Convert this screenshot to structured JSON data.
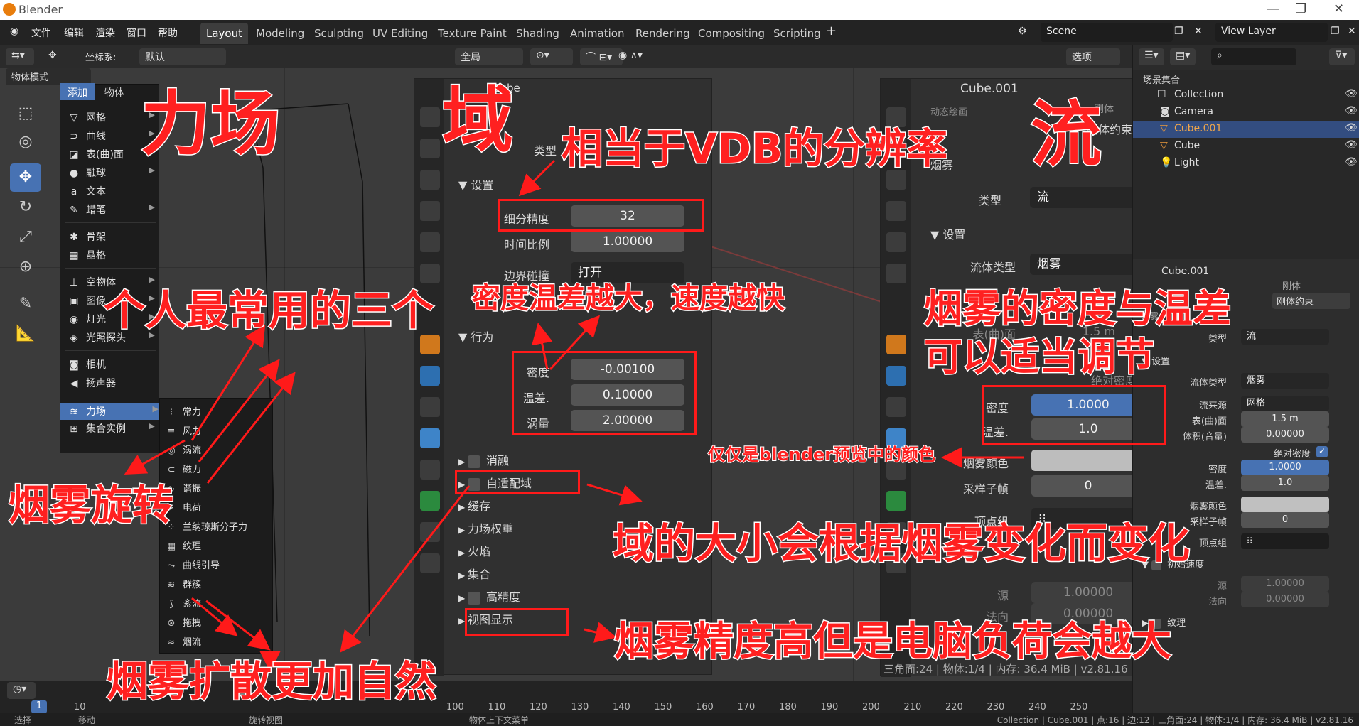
{
  "window": {
    "title": "Blender"
  },
  "menubar": {
    "items": [
      "文件",
      "编辑",
      "渲染",
      "窗口",
      "帮助"
    ],
    "workspace_tabs": [
      "Layout",
      "Modeling",
      "Sculpting",
      "UV Editing",
      "Texture Paint",
      "Shading",
      "Animation",
      "Rendering",
      "Compositing",
      "Scripting"
    ],
    "active_tab": "Layout",
    "scene": "Scene",
    "view_layer": "View Layer"
  },
  "header": {
    "coord_label": "坐标系:",
    "coord_value": "默认",
    "global": "全局",
    "options": "选项",
    "mode": "物体模式"
  },
  "add_menu": {
    "tabs": [
      "添加",
      "物体"
    ],
    "items": [
      {
        "label": "网格",
        "icon": "▽",
        "sub": true
      },
      {
        "label": "曲线",
        "icon": "⊃",
        "sub": true
      },
      {
        "label": "表(曲)面",
        "icon": "◪",
        "sub": true
      },
      {
        "label": "融球",
        "icon": "●",
        "sub": true
      },
      {
        "label": "文本",
        "icon": "a",
        "sub": false
      },
      {
        "label": "蜡笔",
        "icon": "✎",
        "sub": true
      },
      {
        "label": "骨架",
        "icon": "✱",
        "sub": false
      },
      {
        "label": "晶格",
        "icon": "▦",
        "sub": false
      },
      {
        "label": "空物体",
        "icon": "⊥",
        "sub": true
      },
      {
        "label": "图像",
        "icon": "▣",
        "sub": true
      },
      {
        "label": "灯光",
        "icon": "◉",
        "sub": true
      },
      {
        "label": "光照探头",
        "icon": "◈",
        "sub": true
      },
      {
        "label": "相机",
        "icon": "◙",
        "sub": false
      },
      {
        "label": "扬声器",
        "icon": "◀",
        "sub": false
      },
      {
        "label": "力场",
        "icon": "≋",
        "sub": true
      },
      {
        "label": "集合实例",
        "icon": "⊞",
        "sub": true
      }
    ]
  },
  "force_submenu": {
    "items": [
      "常力",
      "风力",
      "涡流",
      "磁力",
      "谐振",
      "电荷",
      "兰纳琼斯分子力",
      "纹理",
      "曲线引导",
      "群簇",
      "紊流",
      "拖拽",
      "烟流"
    ]
  },
  "domain_panel": {
    "object": "Cube",
    "type_label": "类型",
    "settings": "设置",
    "resolution_label": "细分精度",
    "resolution_value": "32",
    "time_scale_label": "时间比例",
    "time_scale_value": "1.00000",
    "border_label": "边界碰撞",
    "border_value": "打开",
    "behavior": "行为",
    "density_label": "密度",
    "density_value": "-0.00100",
    "heat_label": "温差.",
    "heat_value": "0.10000",
    "vorticity_label": "涡量",
    "vorticity_value": "2.00000",
    "sections": [
      "消融",
      "自适配域",
      "缓存",
      "力场权重",
      "火焰",
      "集合",
      "高精度",
      "视图显示"
    ]
  },
  "flow_panel": {
    "object": "Cube.001",
    "smoke": "烟雾",
    "type_label": "类型",
    "type_value": "流",
    "settings": "设置",
    "flow_type_label": "流体类型",
    "flow_type_value": "烟雾",
    "surface": "表(曲)面",
    "surface_value": "1.5 m",
    "abs_density": "绝对密度",
    "density_label": "密度",
    "density_value": "1.0000",
    "heat_label": "温差.",
    "heat_value": "1.0",
    "color_label": "烟雾颜色",
    "subframes_label": "采样子帧",
    "subframes_value": "0",
    "vgroup_label": "顶点组",
    "source_label": "源",
    "source_value": "1.00000",
    "normal_label": "法向",
    "normal_value": "0.00000",
    "top_buttons": [
      "动态绘画",
      "刚体",
      "刚体约束"
    ],
    "status": "三角面:24 | 物体:1/4 | 内存: 36.4 MiB | v2.81.16"
  },
  "outliner": {
    "header": "场景集合",
    "rows": [
      "Collection",
      "Camera",
      "Cube.001",
      "Cube",
      "Light"
    ]
  },
  "side_props": {
    "object": "Cube.001",
    "buttons": [
      "刚体",
      "刚体约束"
    ],
    "smoke": "烟雾",
    "type_label": "类型",
    "type_value": "流",
    "settings": "设置",
    "flow_type_label": "流体类型",
    "flow_type_value": "烟雾",
    "flow_source_label": "流来源",
    "flow_source_value": "网格",
    "surface_label": "表(曲)面",
    "surface_value": "1.5 m",
    "volume_label": "体积(音量)",
    "volume_value": "0.00000",
    "abs_density": "绝对密度",
    "density_label": "密度",
    "density_value": "1.0000",
    "heat_label": "温差.",
    "heat_value": "1.0",
    "color_label": "烟雾颜色",
    "subframes_label": "采样子帧",
    "subframes_value": "0",
    "vgroup_label": "顶点组",
    "initial_velocity": "初始速度",
    "source_label": "源",
    "source_value": "1.00000",
    "normal_label": "法向",
    "normal_value": "0.00000",
    "texture": "纹理"
  },
  "timeline": {
    "frame_current": "1",
    "ticks": [
      "10",
      "100",
      "110",
      "120",
      "130",
      "140",
      "150",
      "160",
      "170",
      "180",
      "190",
      "200",
      "210",
      "220",
      "230",
      "240",
      "250"
    ]
  },
  "statusbar": {
    "select": "选择",
    "move": "移动",
    "rotate": "旋转视图",
    "ctx": "物体上下文菜单",
    "info": "Collection | Cube.001 | 点:16 | 边:12 | 三角面:24 | 物体:1/4 | 内存: 36.4 MiB | v2.81.16"
  },
  "annotations": {
    "force_field": "力场",
    "domain": "域",
    "flow": "流",
    "resolution_note": "相当于VDB的分辨率",
    "three_note": "个人最常用的三个",
    "density_note": "密度温差越大，速度越快",
    "flow_density_note_1": "烟雾的密度与温差",
    "flow_density_note_2": "可以适当调节",
    "color_note": "仅仅是blender预览中的颜色",
    "rotation_note": "烟雾旋转",
    "adaptive_note": "域的大小会根据烟雾变化而变化",
    "precision_note": "烟雾精度高但是电脑负荷会越大",
    "diffuse_note": "烟雾扩散更加自然"
  },
  "colors": {
    "accent_blue": "#4772b3",
    "annotation_red": "#ff2020",
    "selected_row": "#334d80"
  }
}
